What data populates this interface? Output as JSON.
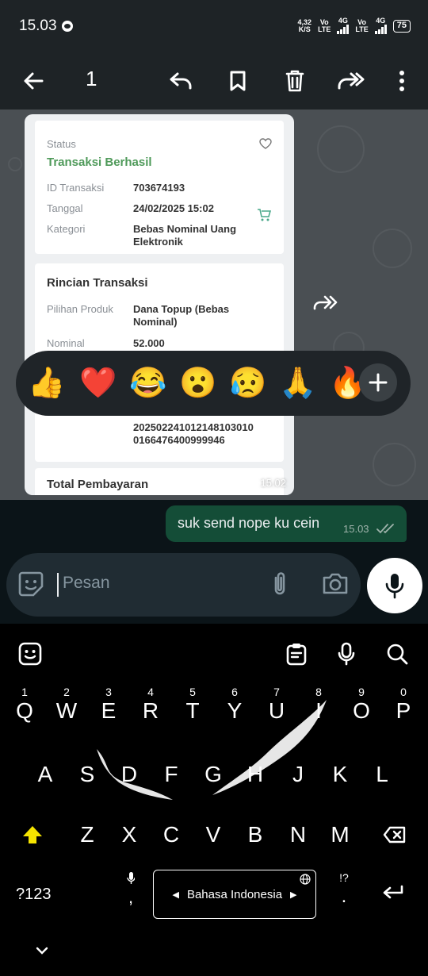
{
  "status_bar": {
    "time": "15.03",
    "speed_value": "4,32",
    "speed_unit": "K/S",
    "sim1_label_top": "Vo",
    "sim1_label_bottom": "LTE",
    "sim1_network": "4G",
    "sim2_label_top": "Vo",
    "sim2_label_bottom": "LTE",
    "sim2_network": "4G",
    "battery": "75"
  },
  "toolbar": {
    "selected_count": "1",
    "icons": [
      "back-arrow-icon",
      "reply-icon",
      "bookmark-icon",
      "delete-icon",
      "forward-icon",
      "more-icon"
    ]
  },
  "image_message": {
    "status_label": "Status",
    "status_value": "Transaksi Berhasil",
    "id_label": "ID Transaksi",
    "id_value": "703674193",
    "date_label": "Tanggal",
    "date_value": "24/02/2025 15:02",
    "category_label": "Kategori",
    "category_value_line1": "Bebas Nominal Uang",
    "category_value_line2": "Elektronik",
    "details_title": "Rincian Transaksi",
    "product_label": "Pilihan Produk",
    "product_value_line1": "Dana Topup (Bebas",
    "product_value_line2": "Nominal)",
    "nominal_label": "Nominal",
    "nominal_value": "52.000",
    "ref_line1": "2025022410121481030​10",
    "ref_line2": "0166476400999946",
    "total_label": "Total Pembayaran",
    "time": "15.02"
  },
  "reactions": [
    "👍",
    "❤️",
    "😂",
    "😮",
    "😥",
    "🙏",
    "🔥"
  ],
  "sent_message": {
    "text": "suk send nope ku cein",
    "time": "15.03"
  },
  "input": {
    "placeholder": "Pesan"
  },
  "keyboard": {
    "number_hints": [
      "1",
      "2",
      "3",
      "4",
      "5",
      "6",
      "7",
      "8",
      "9",
      "0"
    ],
    "row1": [
      "Q",
      "W",
      "E",
      "R",
      "T",
      "Y",
      "U",
      "I",
      "O",
      "P"
    ],
    "row2": [
      "A",
      "S",
      "D",
      "F",
      "G",
      "H",
      "J",
      "K",
      "L"
    ],
    "row3": [
      "Z",
      "X",
      "C",
      "V",
      "B",
      "N",
      "M"
    ],
    "symbols_key": "?123",
    "comma": ",",
    "period": ".",
    "period_hint": "!?",
    "language": "Bahasa Indonesia",
    "accent_color": "#f5e400"
  }
}
